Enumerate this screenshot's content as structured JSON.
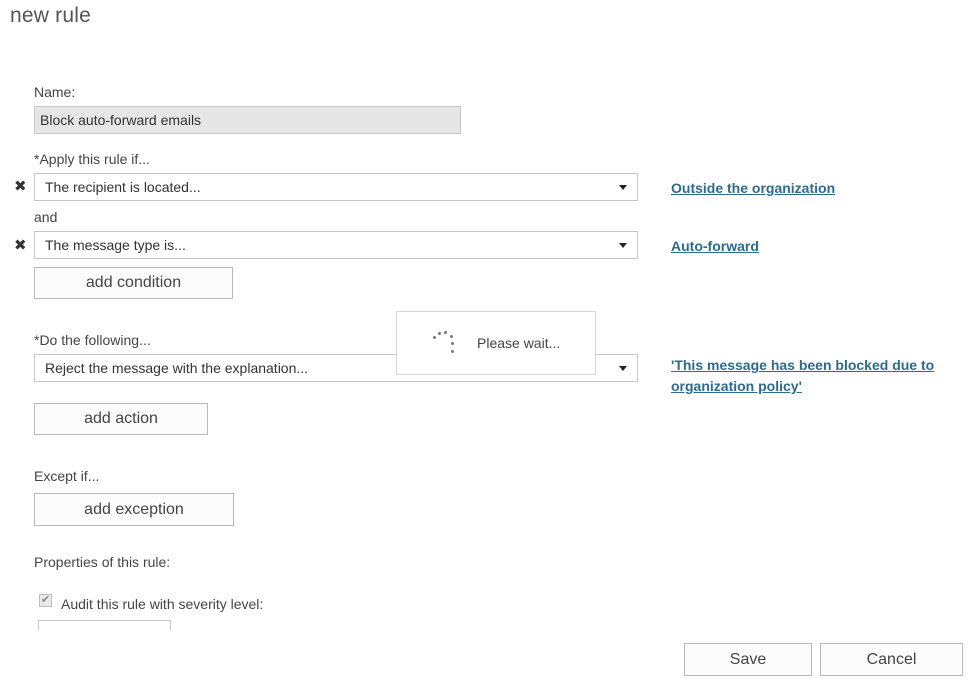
{
  "page": {
    "title": "new rule"
  },
  "name": {
    "label": "Name:",
    "value": "Block auto-forward emails"
  },
  "conditions": {
    "label": "*Apply this rule if...",
    "connector": "and",
    "items": [
      {
        "select": "The recipient is located...",
        "value_link": "Outside the organization"
      },
      {
        "select": "The message type is...",
        "value_link": "Auto-forward"
      }
    ],
    "add_label": "add condition"
  },
  "actions": {
    "label": "*Do the following...",
    "items": [
      {
        "select": "Reject the message with the explanation...",
        "value_link": "'This message has been blocked due to organization policy'"
      }
    ],
    "add_label": "add action"
  },
  "exceptions": {
    "label": "Except if...",
    "add_label": "add exception"
  },
  "properties": {
    "label": "Properties of this rule:",
    "audit_label": "Audit this rule with severity level:",
    "audit_checked": true
  },
  "overlay": {
    "wait_text": "Please wait..."
  },
  "footer": {
    "save_label": "Save",
    "cancel_label": "Cancel"
  },
  "icons": {
    "remove": "x-icon",
    "dropdown": "chevron-down-icon",
    "loading": "spinner-icon",
    "check": "checkmark-icon"
  },
  "colors": {
    "link": "#2d6b8e",
    "input_bg": "#e6e6e6",
    "border": "#c6c6c6"
  }
}
